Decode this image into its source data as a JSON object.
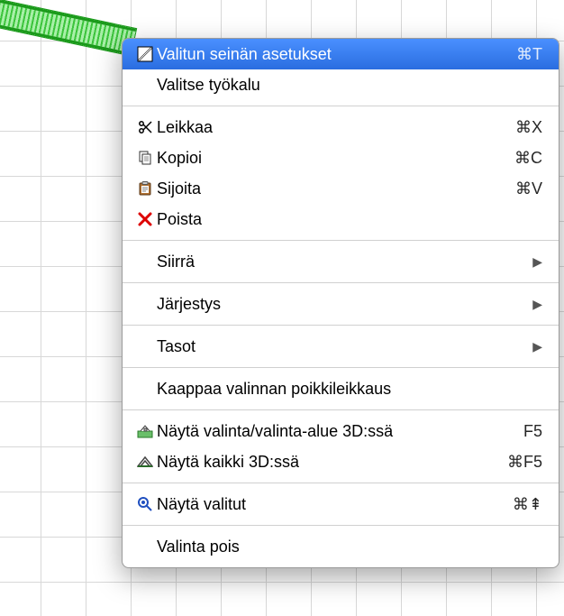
{
  "menu": {
    "items": {
      "settings": {
        "label": "Valitun seinän asetukset",
        "shortcut": "⌘T"
      },
      "select_tool": {
        "label": "Valitse työkalu"
      },
      "cut": {
        "label": "Leikkaa",
        "shortcut": "⌘X"
      },
      "copy": {
        "label": "Kopioi",
        "shortcut": "⌘C"
      },
      "paste": {
        "label": "Sijoita",
        "shortcut": "⌘V"
      },
      "delete": {
        "label": "Poista"
      },
      "move": {
        "label": "Siirrä"
      },
      "arrange": {
        "label": "Järjestys"
      },
      "layers": {
        "label": "Tasot"
      },
      "capture": {
        "label": "Kaappaa valinnan poikkileikkaus"
      },
      "show_sel_3d": {
        "label": "Näytä valinta/valinta-alue 3D:ssä",
        "shortcut": "F5"
      },
      "show_all_3d": {
        "label": "Näytä kaikki 3D:ssä",
        "shortcut": "⌘F5"
      },
      "show_selected": {
        "label": "Näytä valitut",
        "shortcut": "⌘⇞"
      },
      "deselect": {
        "label": "Valinta pois"
      }
    }
  }
}
